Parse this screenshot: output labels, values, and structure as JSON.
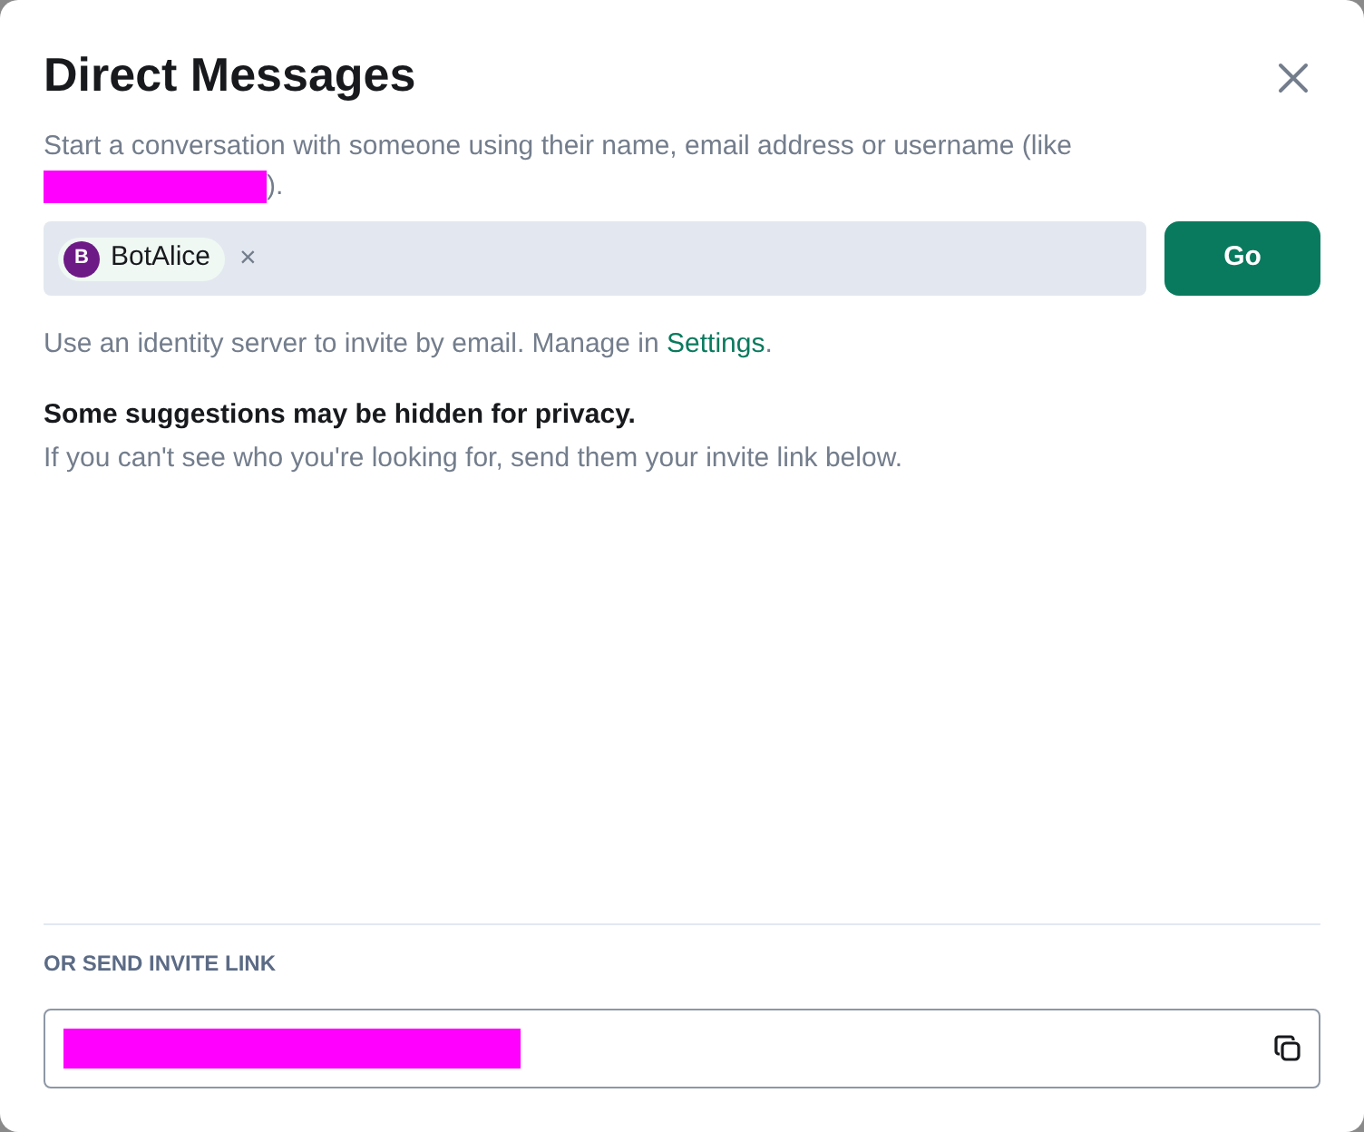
{
  "dialog": {
    "title": "Direct Messages",
    "intro_before": "Start a conversation with someone using their name, email address or username (like",
    "intro_after": ")."
  },
  "invitee_field": {
    "pills": [
      {
        "initial": "B",
        "name": "BotAlice",
        "remove": "×"
      }
    ]
  },
  "go_button": "Go",
  "identity_note": {
    "text": "Use an identity server to invite by email. Manage in",
    "link": "Settings",
    "after": "."
  },
  "privacy": {
    "heading": "Some suggestions may be hidden for privacy.",
    "text": "If you can't see who you're looking for, send them your invite link below."
  },
  "invite_link": {
    "heading": "OR SEND INVITE LINK"
  }
}
